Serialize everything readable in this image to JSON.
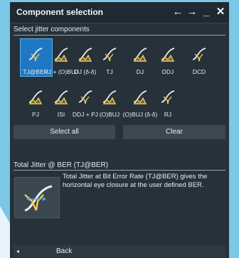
{
  "window": {
    "title": "Component selection",
    "controls": {
      "back": "←",
      "forward": "→",
      "minimize": "_",
      "close": "✕"
    }
  },
  "components": {
    "section_label": "Select jitter components",
    "items": [
      {
        "label": "TJ@BER",
        "icon": "tj-ber-icon",
        "selected": true
      },
      {
        "label": "RJ + (O)BUJ",
        "icon": "rj-obuj-icon",
        "selected": false
      },
      {
        "label": "DJ (δ-δ)",
        "icon": "dj-delta-icon",
        "selected": false
      },
      {
        "label": "TJ",
        "icon": "tj-icon",
        "selected": false
      },
      {
        "label": "DJ",
        "icon": "dj-icon",
        "selected": false
      },
      {
        "label": "DDJ",
        "icon": "ddj-icon",
        "selected": false
      },
      {
        "label": "DCD",
        "icon": "dcd-icon",
        "selected": false
      },
      {
        "label": "PJ",
        "icon": "pj-icon",
        "selected": false
      },
      {
        "label": "ISI",
        "icon": "isi-icon",
        "selected": false
      },
      {
        "label": "DDJ + PJ",
        "icon": "ddj-pj-icon",
        "selected": false
      },
      {
        "label": "(O)BUJ",
        "icon": "obuj-icon",
        "selected": false
      },
      {
        "label": "(O)BUJ (δ-δ)",
        "icon": "obuj-delta-icon",
        "selected": false
      },
      {
        "label": "RJ",
        "icon": "rj-icon",
        "selected": false
      }
    ]
  },
  "actions": {
    "select_all": "Select all",
    "clear": "Clear"
  },
  "detail": {
    "heading": "Total Jitter @ BER (TJ@BER)",
    "description": "Total Jitter at Bit Error Rate (TJ@BER) gives the horizontal eye closure at the user defined BER."
  },
  "footer": {
    "back_label": "Back",
    "back_arrow": "◂"
  },
  "colors": {
    "accent": "#1f78c4",
    "icon_yellow": "#f2c94c",
    "background": "#26313a"
  }
}
